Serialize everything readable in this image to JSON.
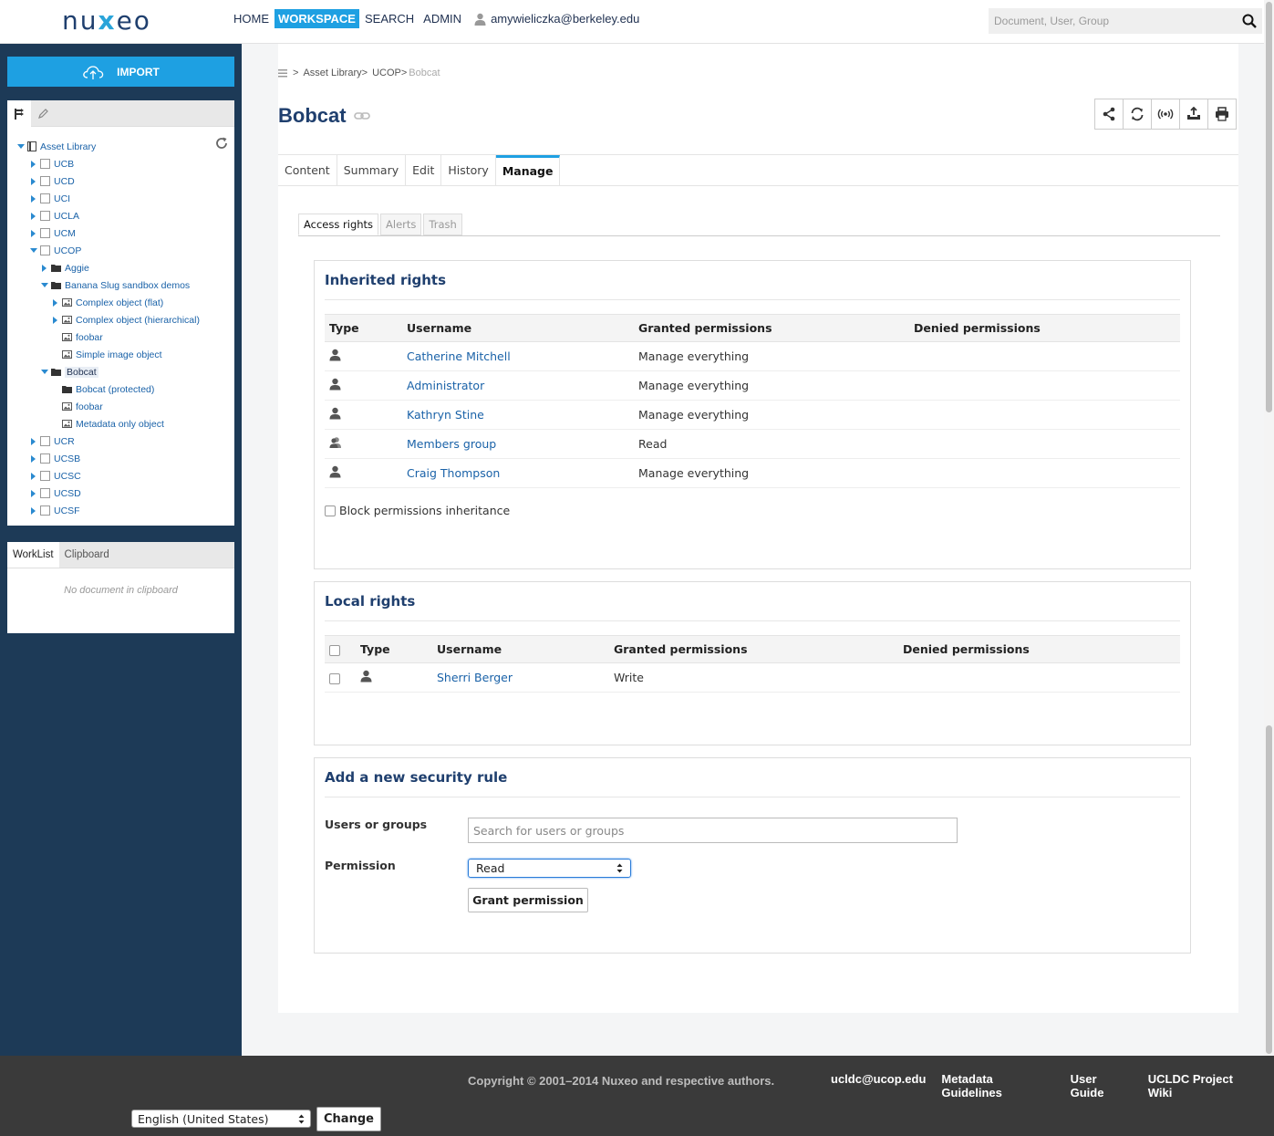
{
  "header": {
    "logo": "nuxeo",
    "nav": [
      {
        "label": "HOME",
        "active": false
      },
      {
        "label": "WORKSPACE",
        "active": true
      },
      {
        "label": "SEARCH",
        "active": false
      },
      {
        "label": "ADMIN",
        "active": false
      }
    ],
    "user": "amywieliczka@berkeley.edu",
    "search_placeholder": "Document, User, Group",
    "accent": "#1ea0e2"
  },
  "sidebar": {
    "import_label": "IMPORT",
    "tree": [
      {
        "label": "Asset Library",
        "level": 0,
        "expanded": true,
        "icon": "book-icon"
      },
      {
        "label": "UCB",
        "level": 1,
        "expanded": false,
        "icon": "collection-icon"
      },
      {
        "label": "UCD",
        "level": 1,
        "expanded": false,
        "icon": "collection-icon"
      },
      {
        "label": "UCI",
        "level": 1,
        "expanded": false,
        "icon": "collection-icon"
      },
      {
        "label": "UCLA",
        "level": 1,
        "expanded": false,
        "icon": "collection-icon"
      },
      {
        "label": "UCM",
        "level": 1,
        "expanded": false,
        "icon": "collection-icon"
      },
      {
        "label": "UCOP",
        "level": 1,
        "expanded": true,
        "icon": "collection-icon"
      },
      {
        "label": "Aggie",
        "level": 2,
        "expanded": false,
        "icon": "folder-icon"
      },
      {
        "label": "Banana Slug sandbox demos",
        "level": 2,
        "expanded": true,
        "icon": "folder-icon"
      },
      {
        "label": "Complex object (flat)",
        "level": 3,
        "expanded": false,
        "icon": "image-icon"
      },
      {
        "label": "Complex object (hierarchical)",
        "level": 3,
        "expanded": false,
        "icon": "image-icon"
      },
      {
        "label": "foobar",
        "level": 3,
        "icon": "image-icon"
      },
      {
        "label": "Simple image object",
        "level": 3,
        "icon": "image-icon"
      },
      {
        "label": "Bobcat",
        "level": 2,
        "expanded": true,
        "icon": "folder-icon",
        "selected": true
      },
      {
        "label": "Bobcat (protected)",
        "level": 3,
        "icon": "folder-icon"
      },
      {
        "label": "foobar",
        "level": 3,
        "icon": "image-icon"
      },
      {
        "label": "Metadata only object",
        "level": 3,
        "icon": "image-icon"
      },
      {
        "label": "UCR",
        "level": 1,
        "expanded": false,
        "icon": "collection-icon"
      },
      {
        "label": "UCSB",
        "level": 1,
        "expanded": false,
        "icon": "collection-icon"
      },
      {
        "label": "UCSC",
        "level": 1,
        "expanded": false,
        "icon": "collection-icon"
      },
      {
        "label": "UCSD",
        "level": 1,
        "expanded": false,
        "icon": "collection-icon"
      },
      {
        "label": "UCSF",
        "level": 1,
        "expanded": false,
        "icon": "collection-icon"
      }
    ],
    "worklist_tabs": [
      "WorkList",
      "Clipboard"
    ],
    "worklist_empty": "No document in clipboard"
  },
  "breadcrumb": {
    "sep": ">",
    "items": [
      "Asset Library",
      "UCOP",
      "Bobcat"
    ]
  },
  "page": {
    "title": "Bobcat",
    "tabs": [
      {
        "label": "Content",
        "active": false
      },
      {
        "label": "Summary",
        "active": false
      },
      {
        "label": "Edit",
        "active": false
      },
      {
        "label": "History",
        "active": false
      },
      {
        "label": "Manage",
        "active": true
      }
    ],
    "subtabs": [
      {
        "label": "Access rights",
        "active": true
      },
      {
        "label": "Alerts",
        "active": false
      },
      {
        "label": "Trash",
        "active": false
      }
    ]
  },
  "inherited": {
    "title": "Inherited rights",
    "columns": [
      "Type",
      "Username",
      "Granted permissions",
      "Denied permissions"
    ],
    "rows": [
      {
        "type": "user",
        "username": "Catherine Mitchell",
        "granted": "Manage everything",
        "denied": ""
      },
      {
        "type": "user",
        "username": "Administrator",
        "granted": "Manage everything",
        "denied": ""
      },
      {
        "type": "user",
        "username": "Kathryn Stine",
        "granted": "Manage everything",
        "denied": ""
      },
      {
        "type": "group",
        "username": "Members group",
        "granted": "Read",
        "denied": ""
      },
      {
        "type": "user",
        "username": "Craig Thompson",
        "granted": "Manage everything",
        "denied": ""
      }
    ],
    "block_label": "Block permissions inheritance"
  },
  "local": {
    "title": "Local rights",
    "columns": [
      "Type",
      "Username",
      "Granted permissions",
      "Denied permissions"
    ],
    "rows": [
      {
        "type": "user",
        "username": "Sherri Berger",
        "granted": "Write",
        "denied": ""
      }
    ]
  },
  "add_rule": {
    "title": "Add a new security rule",
    "users_label": "Users or groups",
    "users_placeholder": "Search for users or groups",
    "permission_label": "Permission",
    "permission_value": "Read",
    "grant_label": "Grant permission"
  },
  "footer": {
    "copyright": "Copyright © 2001–2014 Nuxeo and respective authors.",
    "links": [
      "ucldc@ucop.edu",
      "Metadata Guidelines",
      "User Guide",
      "UCLDC Project Wiki"
    ],
    "language": "English (United States)",
    "change_label": "Change"
  }
}
